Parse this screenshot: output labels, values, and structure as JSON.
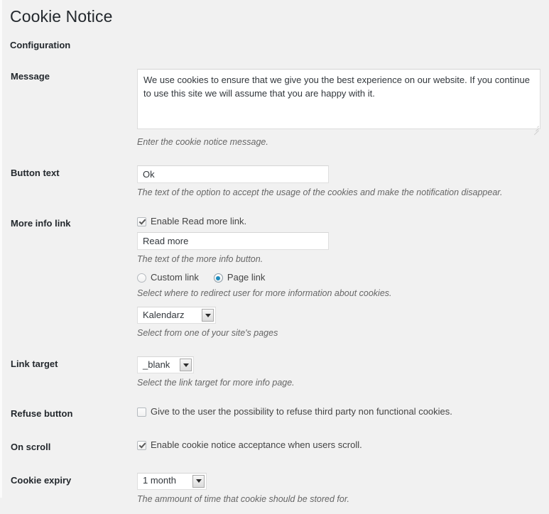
{
  "page": {
    "title": "Cookie Notice",
    "section_title": "Configuration"
  },
  "fields": {
    "message": {
      "label": "Message",
      "value": "We use cookies to ensure that we give you the best experience on our website. If you continue to use this site we will assume that you are happy with it.",
      "description": "Enter the cookie notice message."
    },
    "button_text": {
      "label": "Button text",
      "value": "Ok",
      "description": "The text of the option to accept the usage of the cookies and make the notification disappear."
    },
    "more_info_link": {
      "label": "More info link",
      "enable_label": "Enable Read more link.",
      "enable_checked": true,
      "link_text_value": "Read more",
      "link_text_description": "The text of the more info button.",
      "radio_custom_label": "Custom link",
      "radio_page_label": "Page link",
      "radio_selected": "Page link",
      "redirect_description": "Select where to redirect user for more information about cookies.",
      "page_select_value": "Kalendarz",
      "page_select_description": "Select from one of your site's pages"
    },
    "link_target": {
      "label": "Link target",
      "value": "_blank",
      "description": "Select the link target for more info page."
    },
    "refuse_button": {
      "label": "Refuse button",
      "checkbox_label": "Give to the user the possibility to refuse third party non functional cookies.",
      "checked": false
    },
    "on_scroll": {
      "label": "On scroll",
      "checkbox_label": "Enable cookie notice acceptance when users scroll.",
      "checked": true
    },
    "cookie_expiry": {
      "label": "Cookie expiry",
      "value": "1 month",
      "description": "The ammount of time that cookie should be stored for."
    }
  }
}
